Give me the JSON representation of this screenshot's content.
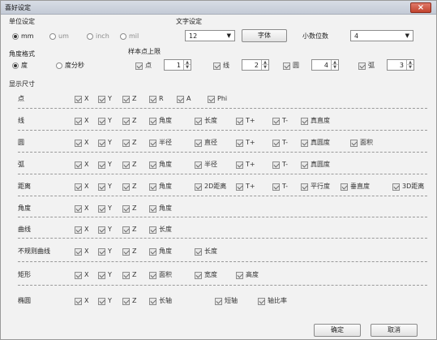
{
  "window": {
    "title": "喜好设定",
    "close_glyph": "×"
  },
  "unit": {
    "title": "单位设定",
    "options": [
      "mm",
      "um",
      "inch",
      "mil"
    ],
    "selected": "mm"
  },
  "text_setting": {
    "title": "文字设定",
    "font_size": "12",
    "font_button": "字体",
    "decimals_label": "小数位数",
    "decimals": "4"
  },
  "angle_format": {
    "title": "角度格式",
    "options": [
      "度",
      "度分秒"
    ],
    "selected": "度"
  },
  "sample_limit": {
    "title": "样本点上限",
    "items": [
      {
        "label": "点",
        "value": "1"
      },
      {
        "label": "线",
        "value": "2"
      },
      {
        "label": "圆",
        "value": "4"
      },
      {
        "label": "弧",
        "value": "3"
      }
    ]
  },
  "display": {
    "title": "显示尺寸",
    "rows": [
      {
        "label": "点",
        "items": [
          "X",
          "Y",
          "Z",
          "R",
          "A",
          "Phi"
        ]
      },
      {
        "label": "线",
        "items": [
          "X",
          "Y",
          "Z",
          "角度",
          "长度",
          "T+",
          "T-",
          "真直度"
        ]
      },
      {
        "label": "圆",
        "items": [
          "X",
          "Y",
          "Z",
          "半径",
          "直径",
          "T+",
          "T-",
          "真圆度",
          "面积"
        ]
      },
      {
        "label": "弧",
        "items": [
          "X",
          "Y",
          "Z",
          "角度",
          "半径",
          "T+",
          "T-",
          "真圆度"
        ]
      },
      {
        "label": "距离",
        "items": [
          "X",
          "Y",
          "Z",
          "角度",
          "2D距离",
          "T+",
          "T-",
          "平行度",
          "垂直度",
          "3D距离"
        ]
      },
      {
        "label": "角度",
        "items": [
          "X",
          "Y",
          "Z",
          "角度"
        ]
      },
      {
        "label": "曲线",
        "items": [
          "X",
          "Y",
          "Z",
          "长度"
        ]
      },
      {
        "label": "不规则曲线",
        "items": [
          "X",
          "Y",
          "Z",
          "角度",
          "长度"
        ]
      },
      {
        "label": "矩形",
        "items": [
          "X",
          "Y",
          "Z",
          "面积",
          "宽度",
          "高度"
        ]
      },
      {
        "label": "椭圆",
        "items": [
          "X",
          "Y",
          "Z",
          "长轴",
          "短轴",
          "轴比率"
        ]
      }
    ]
  },
  "footer": {
    "ok": "确定",
    "cancel": "取消"
  }
}
